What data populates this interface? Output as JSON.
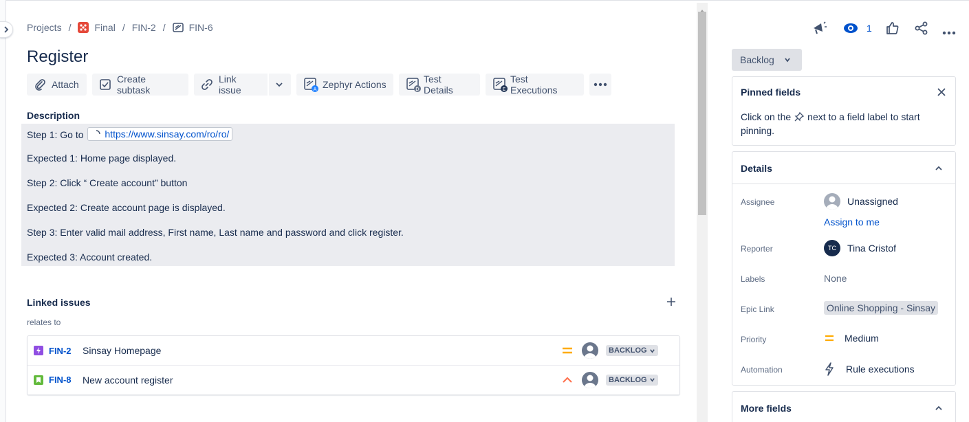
{
  "breadcrumb": {
    "projects": "Projects",
    "project": "Final",
    "parent": "FIN-2",
    "issue": "FIN-6"
  },
  "issue": {
    "title": "Register"
  },
  "toolbar": {
    "attach": "Attach",
    "create_subtask": "Create subtask",
    "link_issue": "Link issue",
    "zephyr_actions": "Zephyr Actions",
    "test_details": "Test Details",
    "test_executions": "Test Executions"
  },
  "description": {
    "label": "Description",
    "step1_prefix": "Step 1: Go to",
    "step1_link": "https://www.sinsay.com/ro/ro/",
    "lines": [
      "Expected 1: Home page displayed.",
      "Step 2: Click “ Create account” button",
      "Expected 2: Create account page is displayed.",
      "Step 3: Enter valid mail address, First name, Last name and password and click register.",
      "Expected 3: Account created."
    ]
  },
  "linked_issues": {
    "label": "Linked issues",
    "relation": "relates to",
    "items": [
      {
        "key": "FIN-2",
        "summary": "Sinsay Homepage",
        "status": "BACKLOG",
        "type_color": "#904ee2",
        "priority": "medium"
      },
      {
        "key": "FIN-8",
        "summary": "New account register",
        "status": "BACKLOG",
        "type_color": "#63ba3c",
        "priority": "high"
      }
    ]
  },
  "header_actions": {
    "watch_count": "1"
  },
  "status": {
    "label": "Backlog"
  },
  "pinned": {
    "title": "Pinned fields",
    "text_before": "Click on the",
    "text_after": "next to a field label to start",
    "text_line2": "pinning."
  },
  "details": {
    "title": "Details",
    "assignee_label": "Assignee",
    "assignee_value": "Unassigned",
    "assign_to_me": "Assign to me",
    "reporter_label": "Reporter",
    "reporter_value": "Tina Cristof",
    "reporter_initials": "TC",
    "labels_label": "Labels",
    "labels_value": "None",
    "epic_label": "Epic Link",
    "epic_value": "Online Shopping - Sinsay",
    "priority_label": "Priority",
    "priority_value": "Medium",
    "automation_label": "Automation",
    "automation_value": "Rule executions"
  },
  "more_fields": {
    "title": "More fields"
  },
  "colors": {
    "link_blue": "#0052cc",
    "medium_priority": "#ffab00",
    "high_priority": "#ff7452",
    "project_icon": "#e5493a"
  }
}
